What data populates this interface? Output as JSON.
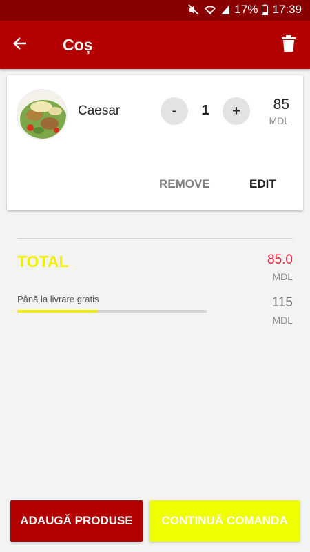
{
  "status_bar": {
    "battery": "17%",
    "time": "17:39",
    "icons": [
      "mute-icon",
      "wifi-icon",
      "signal-icon",
      "battery-icon"
    ]
  },
  "app_bar": {
    "title": "Coș",
    "back_icon": "arrow-left-icon",
    "trash_icon": "trash-icon"
  },
  "cart": {
    "items": [
      {
        "name": "Caesar",
        "quantity": "1",
        "minus_label": "-",
        "plus_label": "+",
        "price": "85",
        "currency": "MDL",
        "remove_label": "REMOVE",
        "edit_label": "EDIT"
      }
    ]
  },
  "summary": {
    "total_label": "TOTAL",
    "total_value": "85.0",
    "total_currency": "MDL",
    "free_delivery_label": "Până la livrare gratis",
    "free_delivery_value": "115",
    "free_delivery_currency": "MDL",
    "free_delivery_progress": 0.425
  },
  "actions": {
    "add_products_label": "ADAUGĂ PRODUSE",
    "continue_order_label": "CONTINUĂ COMANDA"
  },
  "colors": {
    "primary": "#b30000",
    "status_bar": "#8a0000",
    "accent_yellow": "#f0ff00",
    "total_red": "#e8203a"
  }
}
